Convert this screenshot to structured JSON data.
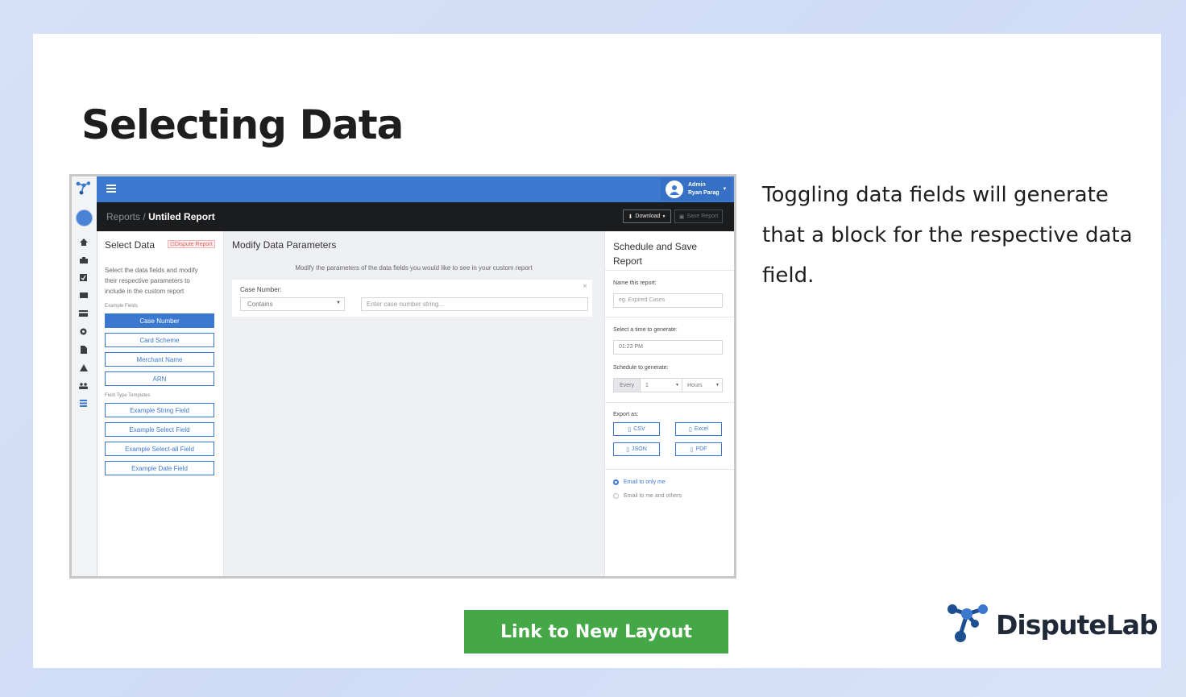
{
  "slide": {
    "title": "Selecting Data",
    "description": "Toggling data fields will generate that a block for the respective data field.",
    "cta_label": "Link to New Layout",
    "brand_name": "DisputeLab",
    "brand_color": "#1d4f91"
  },
  "app": {
    "accent": "#3b78d0",
    "user": {
      "role": "Admin",
      "name": "Ryan Parag"
    },
    "breadcrumb": {
      "parent": "Reports",
      "separator": "/",
      "current": "Untiled Report"
    },
    "actions": {
      "download": "Download",
      "save": "Save Report"
    },
    "rail_icons": [
      "home-icon",
      "briefcase-icon",
      "check-square-icon",
      "inbox-icon",
      "credit-card-icon",
      "gear-icon",
      "document-icon",
      "warning-icon",
      "users-icon",
      "reports-icon"
    ],
    "select_data": {
      "title": "Select Data",
      "dispute_badge": "Dispute Report",
      "intro": "Select the data fields and modify their respective parameters to include in the custom report",
      "example_fields_label": "Example Fields",
      "fields": [
        "Case Number",
        "Card Scheme",
        "Merchant Name",
        "ARN"
      ],
      "templates_label": "Field Type Templates",
      "templates": [
        "Example String Field",
        "Example Select Field",
        "Example Select-all Field",
        "Example Date Field"
      ]
    },
    "modify": {
      "title": "Modify Data Parameters",
      "instruction": "Modify the parameters of the data fields you would like to see in your custom report",
      "card_label": "Case Number:",
      "operator": "Contains",
      "input_placeholder": "Enter case number string..."
    },
    "schedule": {
      "title": "Schedule and Save Report",
      "name_label": "Name this report:",
      "name_placeholder": "eg. Expired Cases",
      "time_label": "Select a time to generate:",
      "time_value": "01:23 PM",
      "schedule_label": "Schedule to generate:",
      "every": "Every",
      "interval": "1",
      "unit": "Hours",
      "export_label": "Export as:",
      "exports": [
        "CSV",
        "Excel",
        "JSON",
        "PDF"
      ],
      "email_options": [
        "Email to only me",
        "Email to me and others"
      ]
    }
  }
}
